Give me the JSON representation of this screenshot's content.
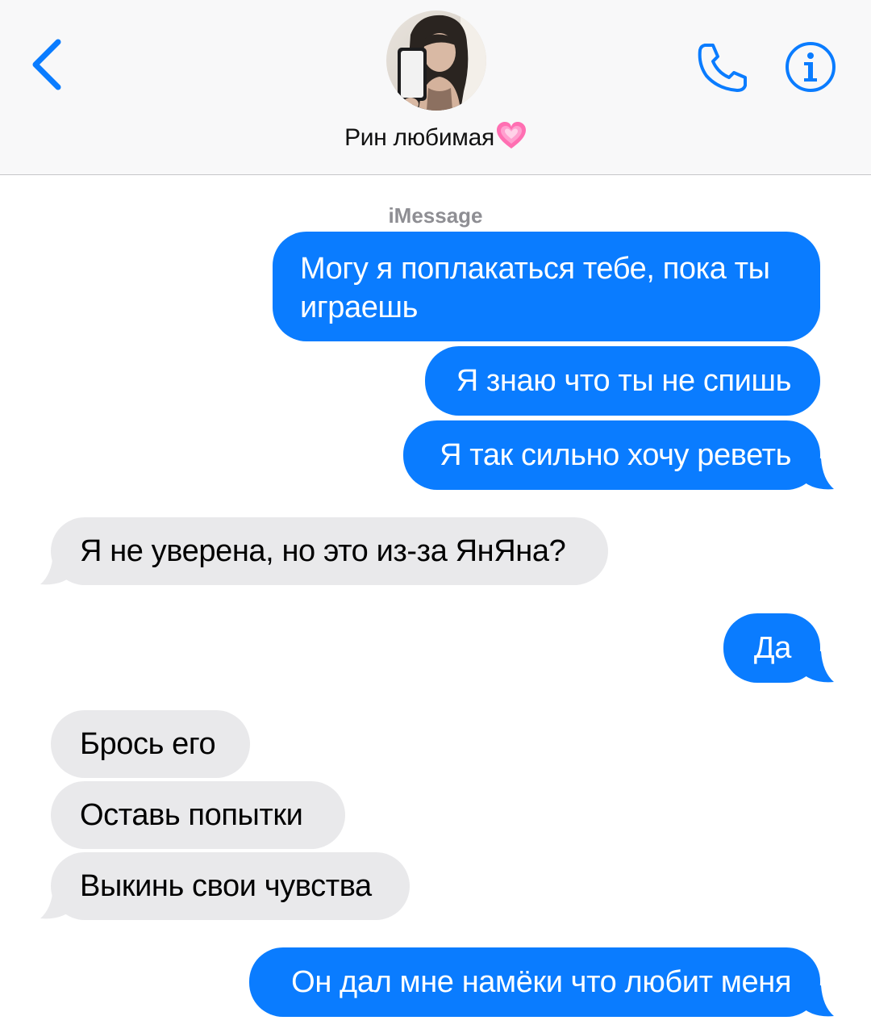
{
  "header": {
    "contact_name": "Рин любимая",
    "heart_emoji": "💗",
    "back_icon": "chevron-left-icon",
    "phone_icon": "phone-icon",
    "info_icon": "info-icon",
    "accent_color": "#0a7cff"
  },
  "conversation": {
    "service_label": "iMessage",
    "messages": [
      {
        "direction": "outgoing",
        "text": "Могу я поплакаться тебе, пока ты играешь"
      },
      {
        "direction": "outgoing",
        "text": "Я знаю что ты не спишь"
      },
      {
        "direction": "outgoing",
        "text": "Я так сильно хочу реветь"
      },
      {
        "direction": "incoming",
        "text": "Я не уверена, но это из-за ЯнЯна?"
      },
      {
        "direction": "outgoing",
        "text": "Да"
      },
      {
        "direction": "incoming",
        "text": "Брось его"
      },
      {
        "direction": "incoming",
        "text": "Оставь попытки"
      },
      {
        "direction": "incoming",
        "text": "Выкинь свои чувства"
      },
      {
        "direction": "outgoing",
        "text": "Он дал мне намёки что любит меня"
      }
    ],
    "colors": {
      "outgoing_bubble": "#0a7cff",
      "incoming_bubble": "#e9e9eb"
    }
  }
}
